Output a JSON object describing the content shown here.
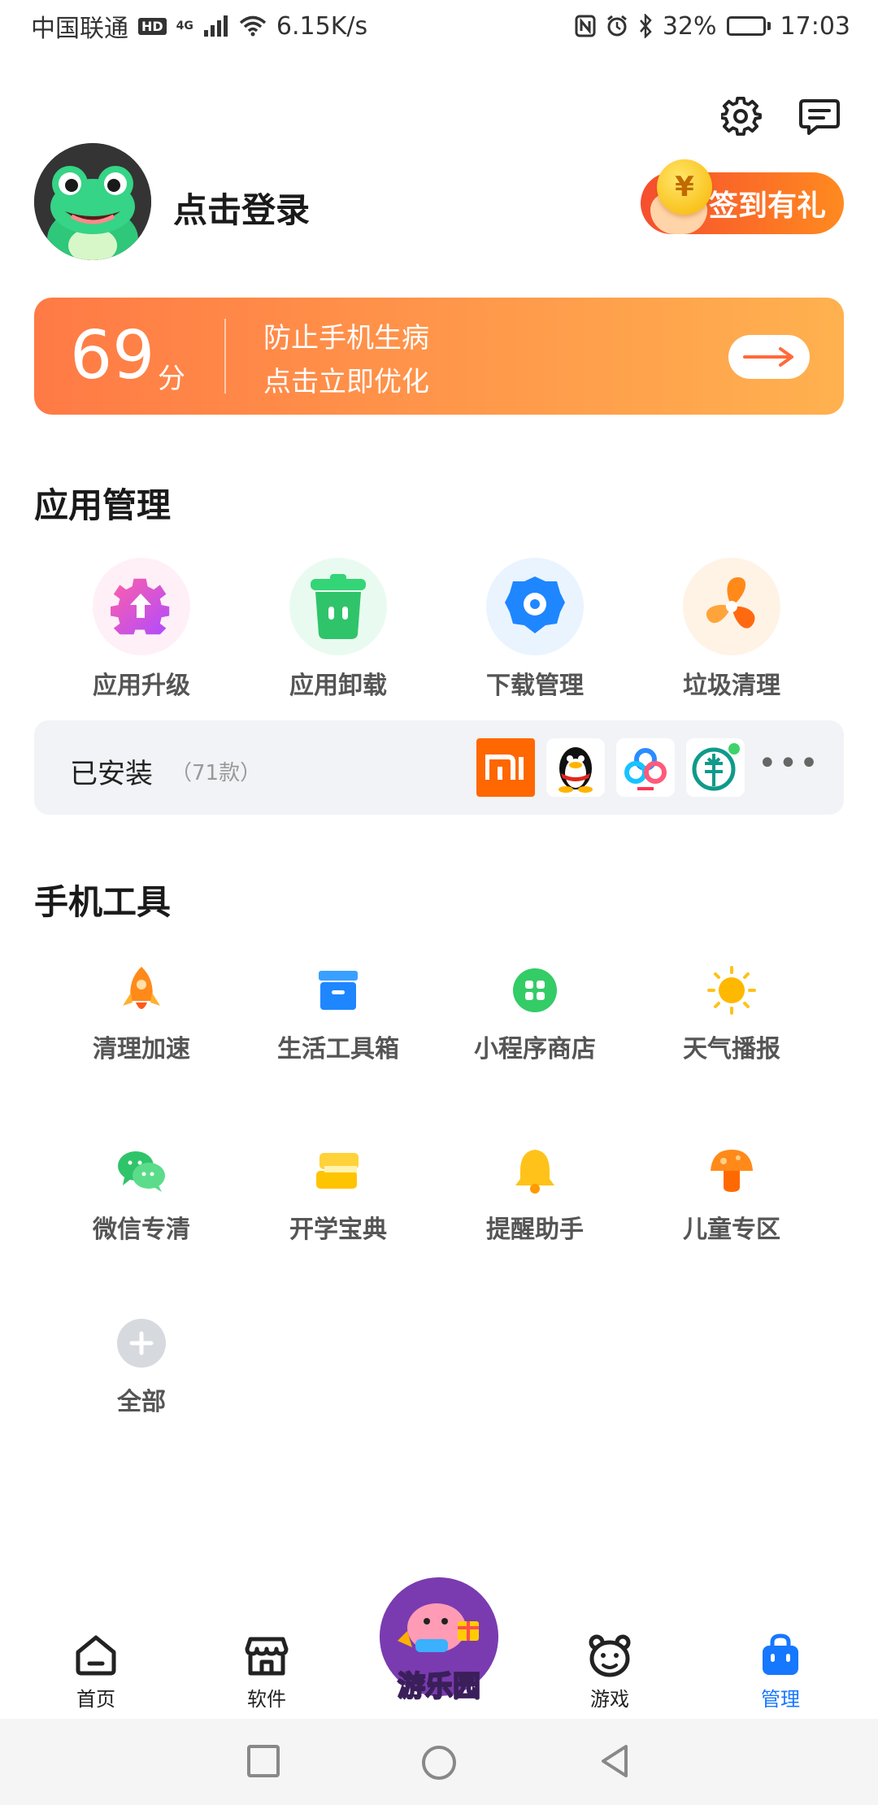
{
  "status_bar": {
    "carrier": "中国联通",
    "hd": "HD",
    "net_gen": "4G",
    "speed": "6.15K/s",
    "battery": "32%",
    "battery_level": 0.32,
    "time": "17:03"
  },
  "header": {
    "settings_icon": "gear-icon",
    "messages_icon": "message-icon"
  },
  "profile": {
    "login_text": "点击登录",
    "checkin_label": "签到有礼",
    "coin_symbol": "¥"
  },
  "score_banner": {
    "score": "69",
    "unit": "分",
    "line1": "防止手机生病",
    "line2": "点击立即优化"
  },
  "app_management": {
    "title": "应用管理",
    "items": [
      {
        "label": "应用升级",
        "icon": "upgrade-gear-icon"
      },
      {
        "label": "应用卸载",
        "icon": "trash-icon"
      },
      {
        "label": "下载管理",
        "icon": "download-gear-icon"
      },
      {
        "label": "垃圾清理",
        "icon": "fan-icon"
      }
    ],
    "installed": {
      "label": "已安装",
      "count": "（71款）",
      "more": "•••"
    }
  },
  "phone_tools": {
    "title": "手机工具",
    "items": [
      {
        "label": "清理加速",
        "icon": "rocket-icon"
      },
      {
        "label": "生活工具箱",
        "icon": "toolbox-icon"
      },
      {
        "label": "小程序商店",
        "icon": "mini-program-icon"
      },
      {
        "label": "天气播报",
        "icon": "sun-icon"
      },
      {
        "label": "微信专清",
        "icon": "wechat-icon"
      },
      {
        "label": "开学宝典",
        "icon": "book-icon"
      },
      {
        "label": "提醒助手",
        "icon": "bell-icon"
      },
      {
        "label": "儿童专区",
        "icon": "mushroom-icon"
      },
      {
        "label": "全部",
        "icon": "plus-icon"
      }
    ]
  },
  "bottom_nav": {
    "items": [
      {
        "label": "首页",
        "icon": "home-icon"
      },
      {
        "label": "软件",
        "icon": "store-icon"
      },
      {
        "label": "游乐园",
        "icon": "playground-icon"
      },
      {
        "label": "游戏",
        "icon": "bear-icon"
      },
      {
        "label": "管理",
        "icon": "bag-icon"
      }
    ],
    "active": "管理"
  },
  "colors": {
    "accent": "#1677ff",
    "banner_start": "#ff7a45",
    "banner_end": "#ffb14f",
    "checkin_start": "#f64e2f",
    "checkin_end": "#ff8a1f"
  }
}
